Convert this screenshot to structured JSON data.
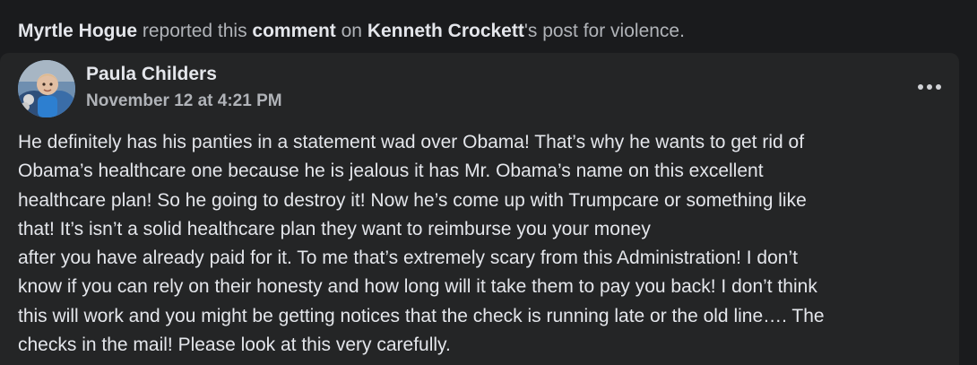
{
  "report": {
    "reporter": "Myrtle Hogue",
    "text1": " reported this ",
    "object": "comment",
    "text2": " on ",
    "post_owner": "Kenneth Crockett",
    "text3": "'s post for violence."
  },
  "comment": {
    "author": "Paula Childers",
    "timestamp": "November 12 at 4:21 PM",
    "more_icon": "more-options-icon",
    "body_lines": [
      "He definitely has his panties in a statement wad over Obama! That’s why he wants to get rid of",
      "Obama’s healthcare one because he is jealous it has Mr. Obama’s name on this excellent",
      "healthcare plan! So he going to destroy it! Now he’s come up with Trumpcare or something like",
      "that! It’s isn’t a solid healthcare plan they want to reimburse you your money",
      "after you have already paid for it. To me that’s extremely scary from this Administration! I don’t",
      "know if you can rely on their honesty and how long will it take them to pay you back! I don’t think",
      "this will work and you might be getting notices that the check is running late or the old line…. The",
      "checks in the mail! Please look at this very carefully."
    ]
  },
  "colors": {
    "background": "#1a1b1d",
    "card": "#242526",
    "primary_text": "#e4e6eb",
    "secondary_text": "#b0b3b8"
  }
}
